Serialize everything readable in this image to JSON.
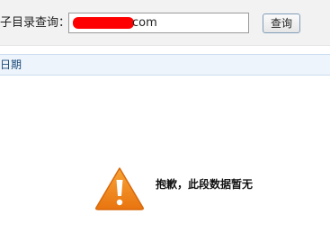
{
  "query": {
    "label": "子目录查询：",
    "input_value": "com",
    "button_label": "查询"
  },
  "table": {
    "date_header": "日期"
  },
  "empty_state": {
    "message": "抱歉，此段数据暂无",
    "icon": "warning-triangle-icon"
  },
  "colors": {
    "redaction": "#ff0000",
    "warning": "#f08a1c",
    "header_text": "#1a4a7a"
  }
}
